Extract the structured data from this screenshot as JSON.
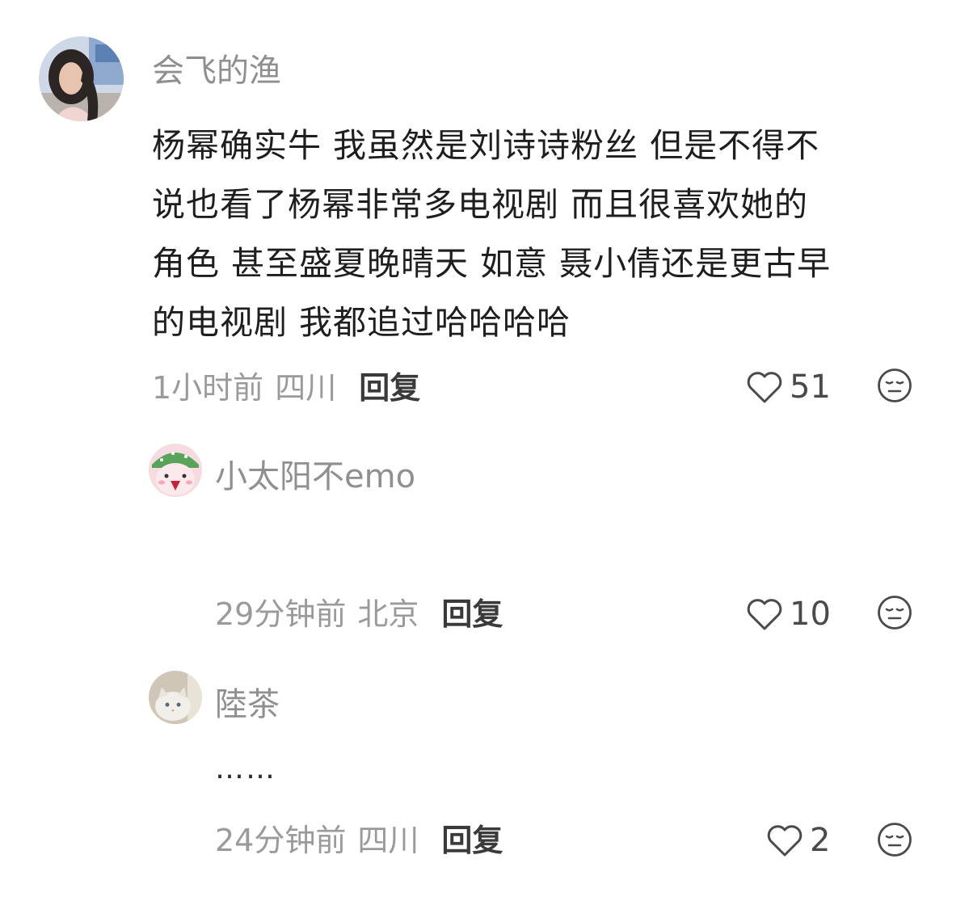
{
  "comment": {
    "username": "会飞的渔",
    "lines": [
      "杨幂确实牛 我虽然是刘诗诗粉丝 但是不得不",
      "说也看了杨幂非常多电视剧 而且很喜欢她的",
      "角色 甚至盛夏晚晴天 如意 聂小倩还是更古早",
      "的电视剧 我都追过哈哈哈哈"
    ],
    "time": "1小时前",
    "location": "四川",
    "reply_label": "回复",
    "likes": "51"
  },
  "replies": [
    {
      "username": "小太阳不emo",
      "text": "",
      "time": "29分钟前",
      "location": "北京",
      "reply_label": "回复",
      "likes": "10"
    },
    {
      "username": "陸茶",
      "text": "……",
      "time": "24分钟前",
      "location": "四川",
      "reply_label": "回复",
      "likes": "2"
    }
  ],
  "icons": {
    "like": "heart-outline-icon",
    "reaction": "face-emoji-icon"
  },
  "colors": {
    "username": "#8f8f8f",
    "body_text": "#1e1e1e",
    "meta": "#9a9a9a",
    "reply": "#3a3a3a"
  }
}
